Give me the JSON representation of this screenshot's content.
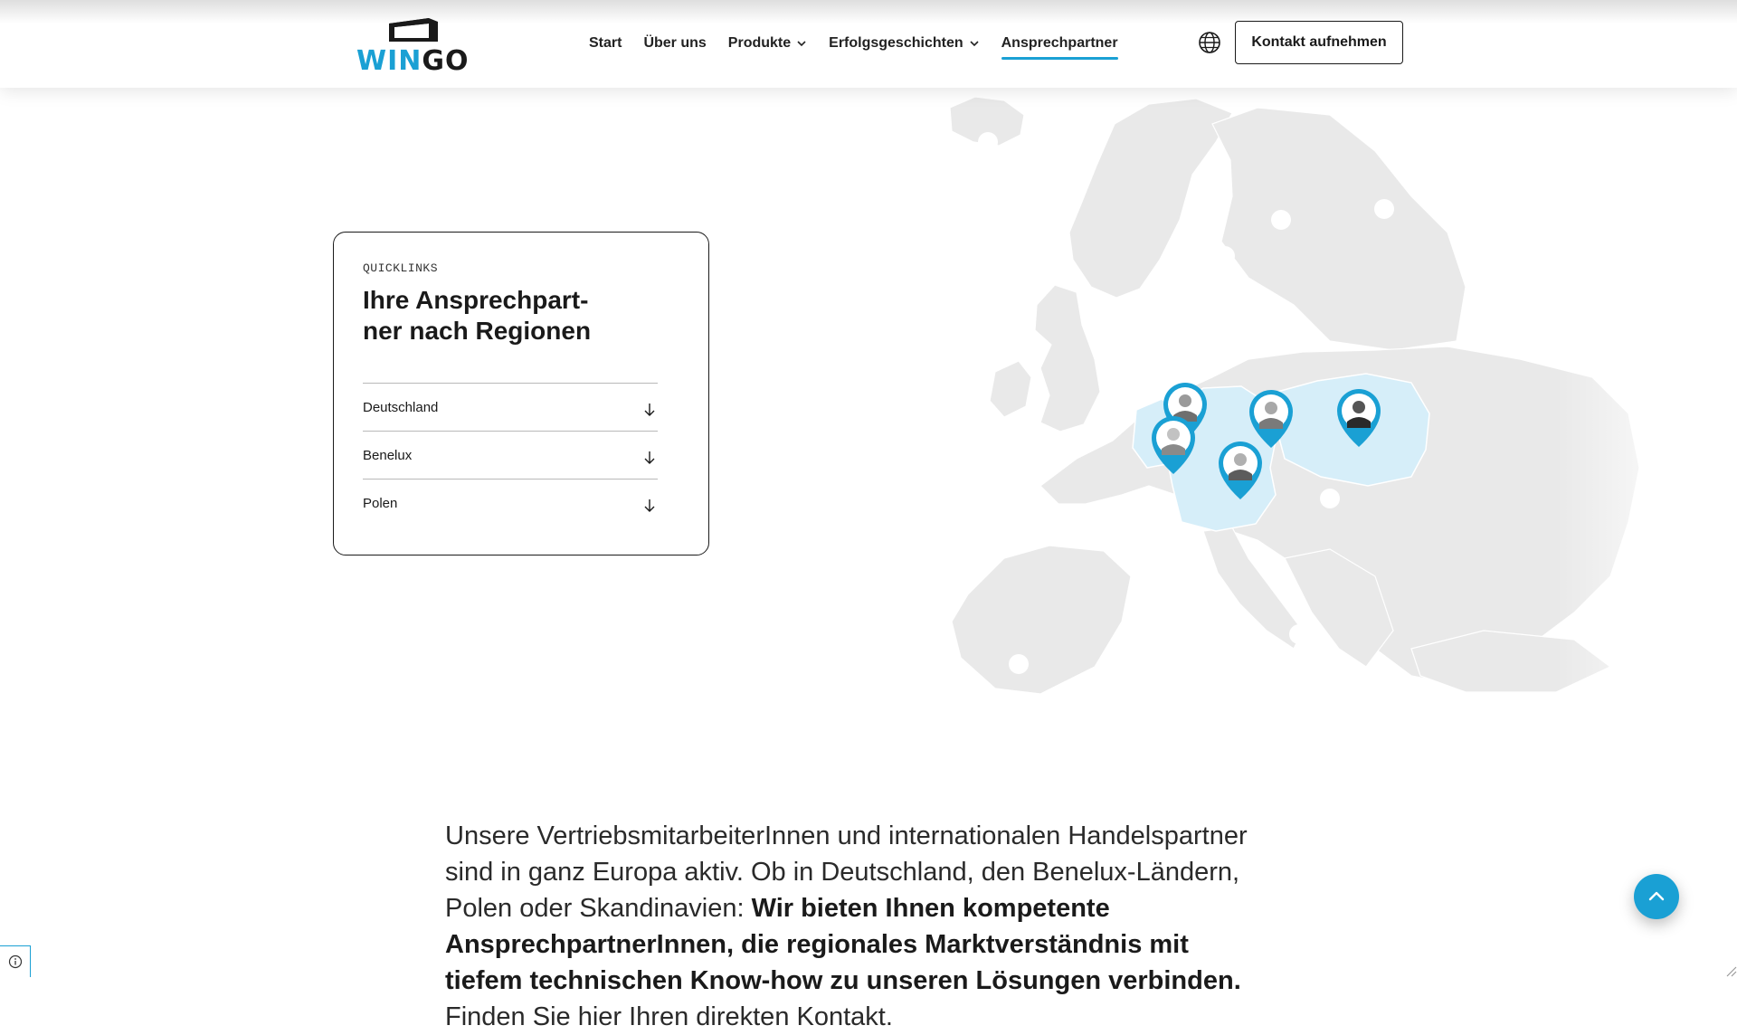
{
  "header": {
    "logo": {
      "text_part1": "WIN",
      "text_part2": "GO"
    },
    "nav": [
      {
        "label": "Start",
        "has_dropdown": false,
        "active": false
      },
      {
        "label": "Über uns",
        "has_dropdown": false,
        "active": false
      },
      {
        "label": "Produkte",
        "has_dropdown": true,
        "active": false
      },
      {
        "label": "Erfolgsgeschichten",
        "has_dropdown": true,
        "active": false
      },
      {
        "label": "Ansprechpartner",
        "has_dropdown": false,
        "active": true
      }
    ],
    "language_icon": "globe-icon",
    "cta_label": "Kontakt aufnehmen"
  },
  "quicklinks": {
    "eyebrow": "QUICKLINKS",
    "title_line1": "Ihre Ansprechpart-",
    "title_line2": "ner nach Regionen",
    "items": [
      {
        "label": "Deutschland",
        "icon": "arrow-down-icon"
      },
      {
        "label": "Benelux",
        "icon": "arrow-down-icon"
      },
      {
        "label": "Polen",
        "icon": "arrow-down-icon"
      }
    ]
  },
  "map": {
    "highlight_regions": [
      "Deutschland",
      "Benelux",
      "Polen"
    ],
    "contact_pins": 5,
    "location_dots": 9
  },
  "intro": {
    "normal_1": "Unsere VertriebsmitarbeiterInnen und internationalen Handelspartner sind in ganz Europa aktiv. Ob in Deutschland, den Benelux-Ländern, Polen oder Skandinavien: ",
    "bold": "Wir bieten Ihnen kompetente AnsprechpartnerInnen, die regionales Marktverständnis mit tiefem technischen Know-how zu unseren Lösungen verbinden.",
    "normal_2": " Finden Sie hier Ihren direkten Kontakt."
  },
  "colors": {
    "accent": "#1aa0d4",
    "highlight_region": "#d6eef9",
    "land": "#e9e9e9",
    "text": "#1a1a1a"
  },
  "floating": {
    "scroll_top_icon": "chevron-up-icon",
    "cookie_icon": "info-icon"
  }
}
